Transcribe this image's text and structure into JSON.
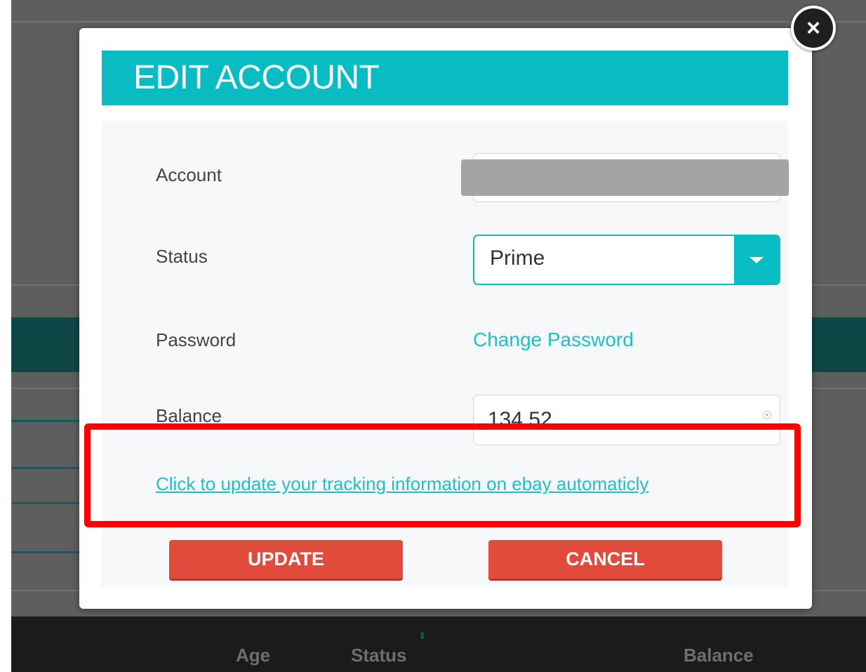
{
  "dialog": {
    "title": "EDIT ACCOUNT",
    "close_icon": "close-icon",
    "fields": {
      "account_label": "Account",
      "status_label": "Status",
      "status_value": "Prime",
      "password_label": "Password",
      "change_password_link": "Change Password",
      "balance_label": "Balance",
      "balance_value": "134.52"
    },
    "tracking_link": "Click to update your tracking information on ebay automaticly",
    "buttons": {
      "update": "UPDATE",
      "cancel": "CANCEL"
    }
  },
  "background_table": {
    "headers": [
      "Age",
      "Status",
      "Balance"
    ]
  },
  "colors": {
    "accent": "#09bcc3",
    "button": "#e24b3b",
    "highlight": "#ff0000"
  }
}
